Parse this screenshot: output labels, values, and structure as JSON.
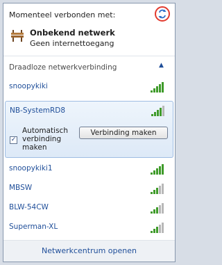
{
  "header": {
    "connected_label": "Momenteel verbonden met:"
  },
  "current_network": {
    "name": "Onbekend netwerk",
    "status": "Geen internettoegang"
  },
  "section": {
    "title": "Draadloze netwerkverbinding"
  },
  "networks": [
    {
      "name": "snoopykiki",
      "signal": 5
    },
    {
      "name": "NB-SystemRD8",
      "signal": 4,
      "selected": true
    },
    {
      "name": "snoopykiki1",
      "signal": 5
    },
    {
      "name": "MBSW",
      "signal": 3
    },
    {
      "name": "BLW-54CW",
      "signal": 3
    },
    {
      "name": "Superman-XL",
      "signal": 3
    }
  ],
  "selected_panel": {
    "auto_connect_label": "Automatisch verbinding maken",
    "auto_connect_checked": true,
    "connect_button": "Verbinding maken"
  },
  "footer": {
    "link": "Netwerkcentrum openen"
  },
  "colors": {
    "link": "#1f4e99",
    "signal_green": "#3f9b2a",
    "signal_grey": "#b8b8b8",
    "highlight": "#e23a2e"
  }
}
